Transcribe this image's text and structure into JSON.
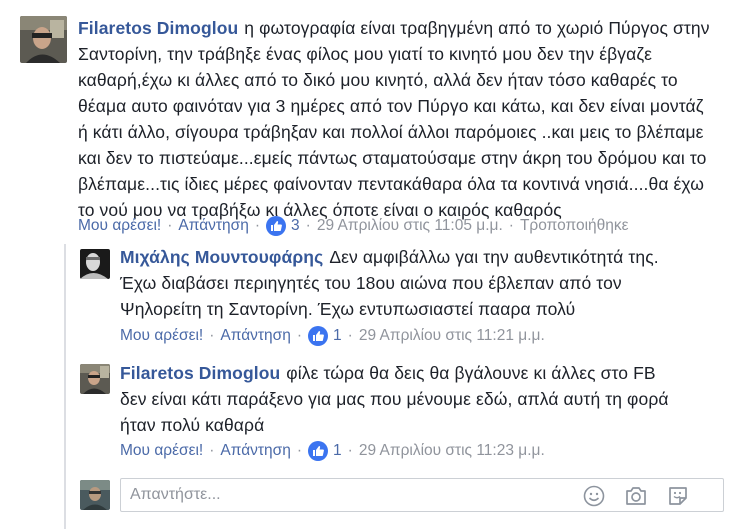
{
  "comments": [
    {
      "author": "Filaretos Dimoglou",
      "text": "η φωτογραφία είναι τραβηγμένη από το χωριό Πύργος στην Σαντορίνη, την τράβηξε ένας φίλος μου γιατί το κινητό μου δεν την έβγαζε καθαρή,έχω κι άλλες από το δικό μου κινητό, αλλά δεν ήταν τόσο καθαρές το θέαμα αυτο φαινόταν για 3 ημέρες από τον Πύργο και κάτω, και δεν είναι μοντάζ ή κάτι άλλο, σίγουρα τράβηξαν και πολλοί άλλοι παρόμοιες ..και μεις το βλέπαμε και δεν το πιστεύαμε...εμείς πάντως σταματούσαμε στην άκρη του δρόμου και το βλέπαμε...τις ίδιες μέρες φαίνονταν πεντακάθαρα όλα τα κοντινά νησιά....θα έχω το νού μου να τραβήξω κι άλλες όποτε είναι ο καιρός καθαρός",
      "like_label": "Μου αρέσει!",
      "reply_label": "Απάντηση",
      "likes": "3",
      "timestamp": "29 Απριλίου στις 11:05 μ.μ.",
      "edited": "Τροποποιήθηκε"
    },
    {
      "author": "Μιχάλης Μουντουφάρης",
      "text": "Δεν αμφιβάλλω γαι την αυθεντικότητά της. Έχω διαβάσει περιηγητές του 18ου αιώνα που έβλεπαν από τον Ψηλορείτη τη Σαντορίνη. Έχω εντυπωσιαστεί πααρα πολύ",
      "like_label": "Μου αρέσει!",
      "reply_label": "Απάντηση",
      "likes": "1",
      "timestamp": "29 Απριλίου στις 11:21 μ.μ."
    },
    {
      "author": "Filaretos Dimoglou",
      "text": "φίλε τώρα θα δεις θα βγάλουνε κι άλλες στο FB δεν είναι κάτι παράξενο για μας που μένουμε εδώ, απλά αυτή τη φορά ήταν πολύ καθαρά",
      "like_label": "Μου αρέσει!",
      "reply_label": "Απάντηση",
      "likes": "1",
      "timestamp": "29 Απριλίου στις 11:23 μ.μ."
    }
  ],
  "reply_box": {
    "placeholder": "Απαντήστε..."
  },
  "icons": [
    "like-thumb-icon",
    "emoji-icon",
    "camera-icon",
    "sticker-icon"
  ],
  "colors": {
    "author": "#365899",
    "link": "#4b6aa8",
    "meta": "#90949c",
    "like_badge": "#3b74f0"
  }
}
